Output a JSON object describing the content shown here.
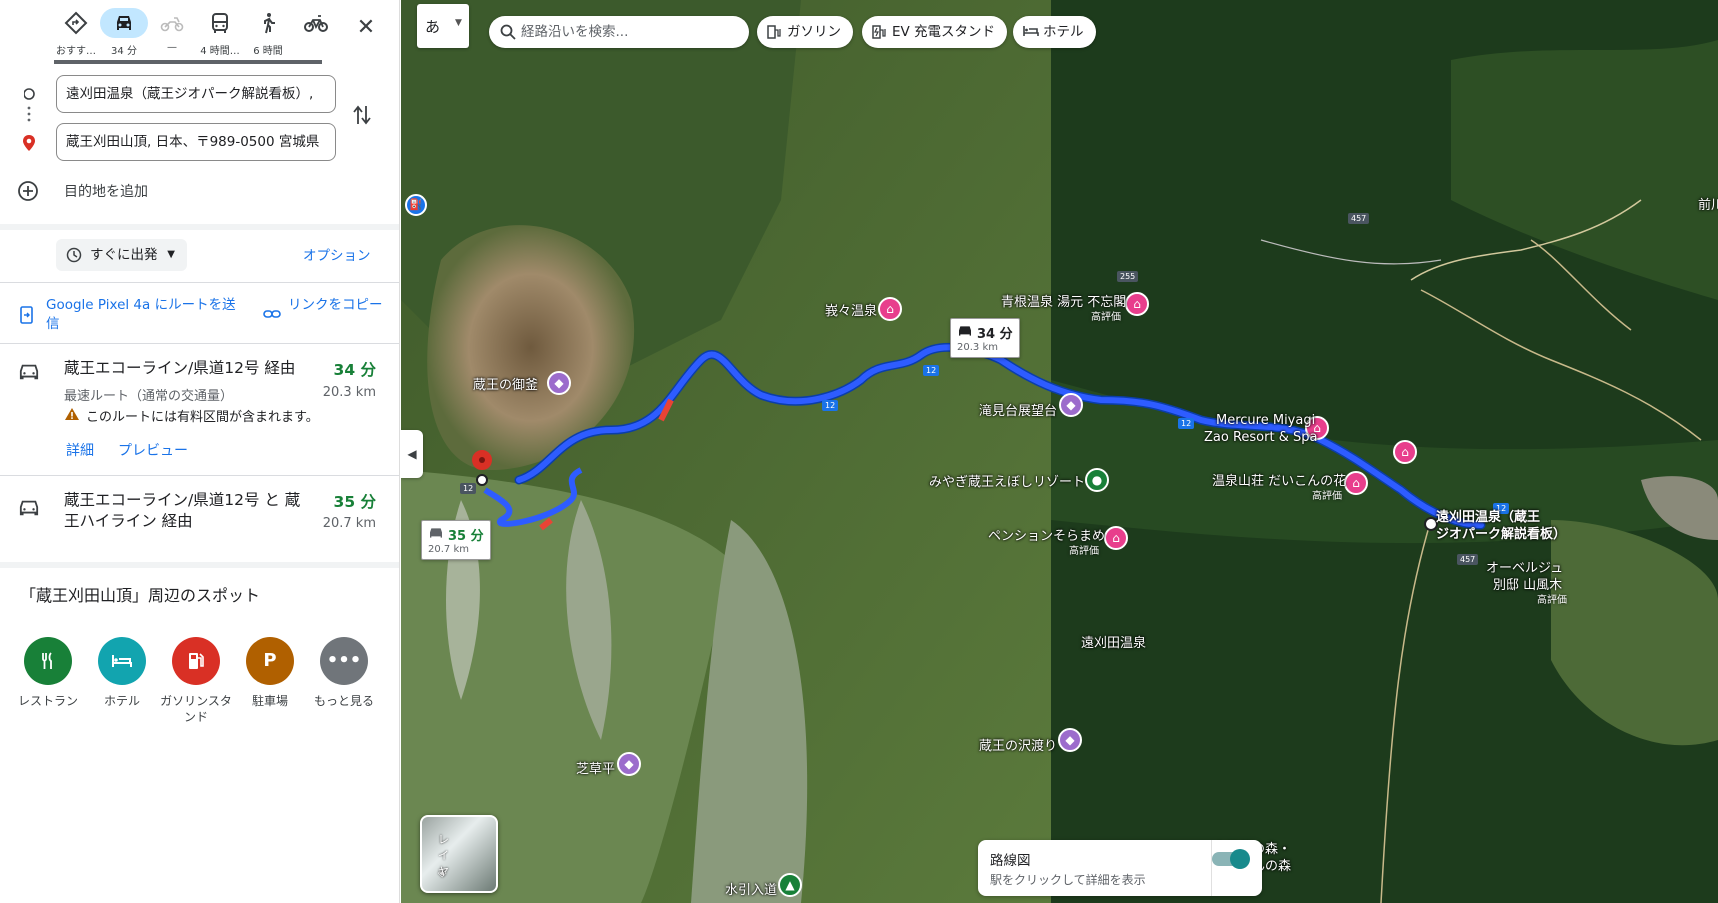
{
  "travel_modes": [
    {
      "name": "best",
      "label": "おすす…"
    },
    {
      "name": "drive",
      "label": "34 分",
      "selected": true
    },
    {
      "name": "motorcycle",
      "label": "—"
    },
    {
      "name": "transit",
      "label": "4 時間…"
    },
    {
      "name": "walk",
      "label": "6 時間"
    },
    {
      "name": "bicycle",
      "label": ""
    }
  ],
  "close_label": "✕",
  "origin": {
    "value": "遠刈田温泉（蔵王ジオパーク解説看板）, "
  },
  "destination": {
    "value": "蔵王刈田山頂, 日本、〒989-0500 宮城県"
  },
  "add_destination": "目的地を追加",
  "depart": {
    "label": "すぐに出発"
  },
  "options_label": "オプション",
  "send_to_phone": "Google Pixel 4a にルートを送信",
  "copy_link": "リンクをコピー",
  "routes": [
    {
      "title": "蔵王エコーライン/県道12号 経由",
      "time": "34 分",
      "distance": "20.3 km",
      "subtitle": "最速ルート（通常の交通量）",
      "warning": "このルートには有料区間が含まれます。",
      "details_label": "詳細",
      "preview_label": "プレビュー"
    },
    {
      "title": "蔵王エコーライン/県道12号 と 蔵王ハイライン 経由",
      "time": "35 分",
      "distance": "20.7 km"
    }
  ],
  "nearby": {
    "title": "「蔵王刈田山頂」周辺のスポット",
    "categories": [
      {
        "label": "レストラン",
        "color": "#188038",
        "icon": "fork-knife-icon"
      },
      {
        "label": "ホテル",
        "color": "#12a4af",
        "icon": "bed-icon"
      },
      {
        "label": "ガソリンスタンド",
        "color": "#d93025",
        "icon": "fuel-icon"
      },
      {
        "label": "駐車場",
        "color": "#b06000",
        "icon": "parking-icon"
      },
      {
        "label": "もっと見る",
        "color": "#70757a",
        "icon": "more-icon"
      }
    ]
  },
  "map": {
    "ime_label": "あ",
    "search_placeholder": "経路沿いを検索...",
    "chips": [
      "ガソリン",
      "EV 充電スタンド",
      "ホテル"
    ],
    "layer_label": "レイヤ",
    "transit_toggle": {
      "title": "路線図",
      "subtitle": "駅をクリックして詳細を表示"
    },
    "callouts": [
      {
        "time": "34 分",
        "distance": "20.3 km"
      },
      {
        "time": "35 分",
        "distance": "20.7 km"
      }
    ],
    "labels": {
      "okama": "蔵王の御釜",
      "gaga": "峩々温泉",
      "aone": "青根温泉 湯元 不忘閣",
      "aone_sub": "高評価",
      "takimi": "滝見台展望台",
      "mercure1": "Mercure Miyagi",
      "mercure2": "Zao Resort & Spa",
      "daikon": "温泉山荘 だいこんの花",
      "daikon_sub": "高評価",
      "eboshi": "みやぎ蔵王えぼしリゾート",
      "soramame": "ペンションそらまめ",
      "soramame_sub": "高評価",
      "togatta_origin": "遠刈田温泉（蔵王",
      "togatta_origin2": "ジオパーク解説看板）",
      "auberge1": "オーベルジュ",
      "auberge2": "別邸 山風木",
      "auberge_sub": "高評価",
      "togatta_area": "遠刈田温泉",
      "sawa": "蔵王の沢渡り",
      "shibakusa": "芝草平",
      "mizubasho1": "水芭蕉の森・",
      "mizubasho2": "どうだんの森",
      "mizuhiki": "水引入道",
      "mae": "前川"
    },
    "shields": [
      "12",
      "457",
      "255"
    ]
  }
}
